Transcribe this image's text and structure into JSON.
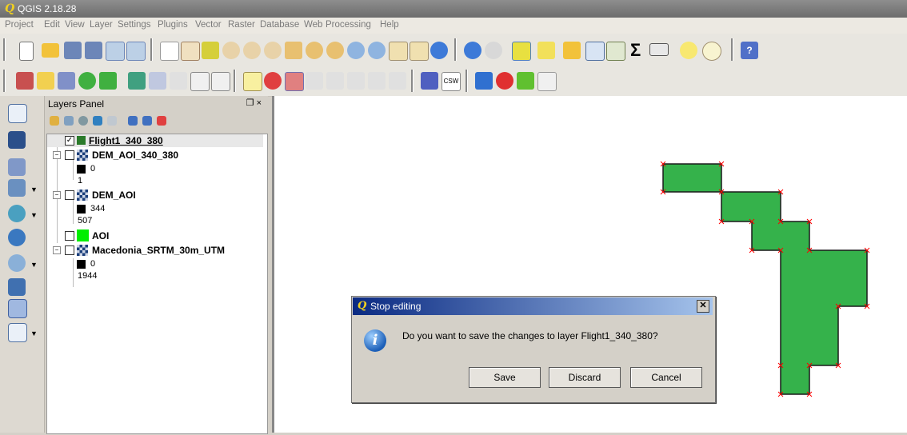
{
  "window": {
    "title": "QGIS 2.18.28"
  },
  "menu": [
    "Project",
    "Edit",
    "View",
    "Layer",
    "Settings",
    "Plugins",
    "Vector",
    "Raster",
    "Database",
    "Web",
    "Processing",
    "Help"
  ],
  "layers_panel": {
    "title": "Layers Panel",
    "float_close": "❐ ×"
  },
  "layers": [
    {
      "name": "Flight1_340_380",
      "checked": true
    },
    {
      "name": "DEM_AOI_340_380",
      "checked": false,
      "legend": [
        "0",
        "1"
      ]
    },
    {
      "name": "DEM_AOI",
      "checked": false,
      "legend": [
        "344",
        "507"
      ]
    },
    {
      "name": "AOI",
      "checked": false
    },
    {
      "name": "Macedonia_SRTM_30m_UTM",
      "checked": false,
      "legend": [
        "0",
        "1944"
      ]
    }
  ],
  "dialog": {
    "title": "Stop editing",
    "message": "Do you want to save the changes to layer Flight1_340_380?",
    "buttons": {
      "save": "Save",
      "discard": "Discard",
      "cancel": "Cancel"
    }
  },
  "icons": {
    "csw": "CSW",
    "sigma": "Σ",
    "help": "?"
  },
  "colors": {
    "polygon_fill": "#35b24b",
    "vertex": "#ff0000",
    "aoi_swatch": "#00ee00"
  }
}
